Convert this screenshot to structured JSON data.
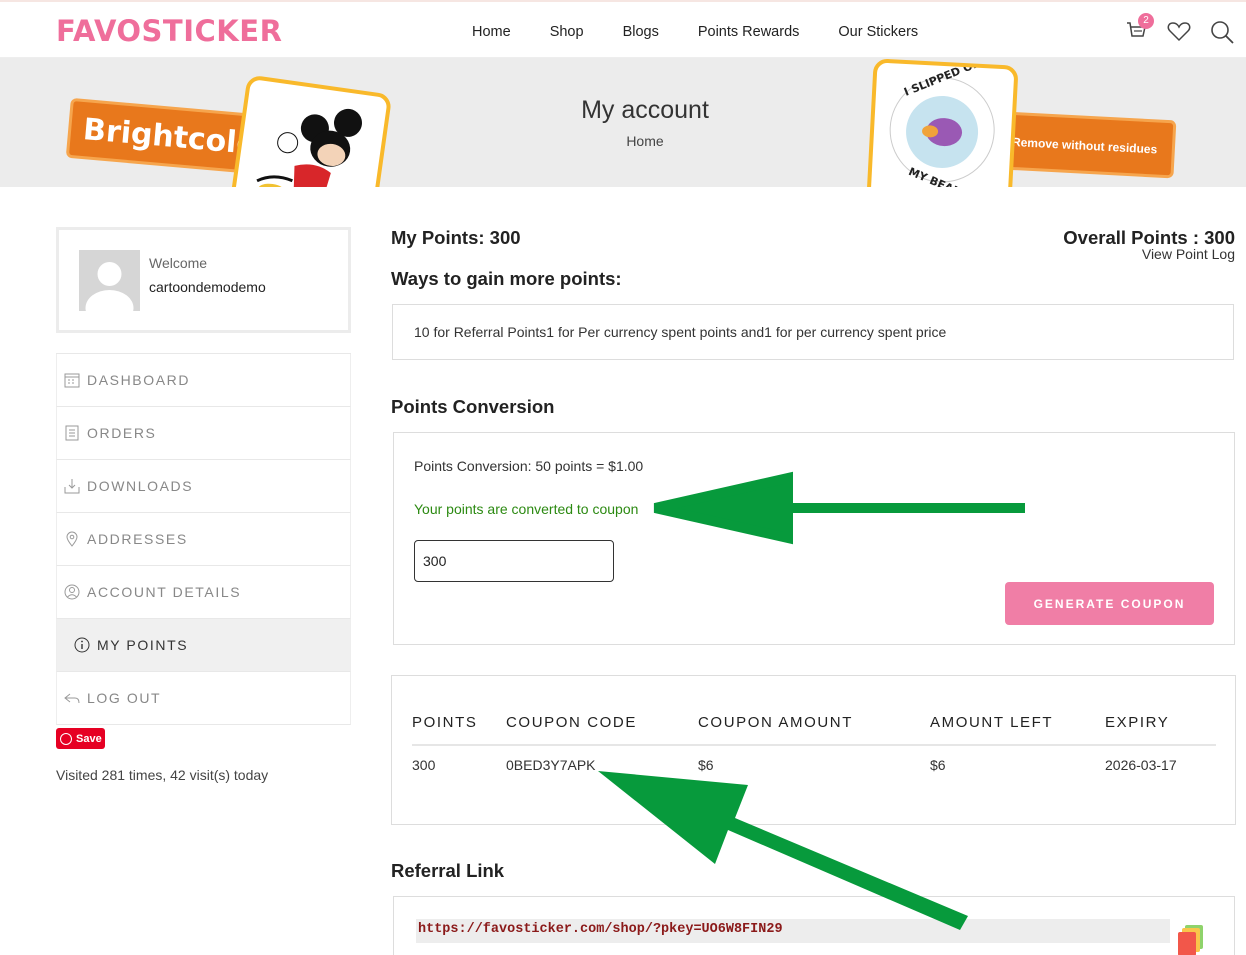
{
  "header": {
    "logo": "FAVOSTICKER",
    "nav": [
      "Home",
      "Shop",
      "Blogs",
      "Points Rewards",
      "Our Stickers"
    ],
    "cart_count": "2",
    "icons": [
      "cart-icon",
      "heart-icon",
      "search-icon"
    ]
  },
  "banner": {
    "title": "My account",
    "breadcrumb": "Home",
    "sticker_left_text": "Brightcolor",
    "sticker_right_text": "Remove without residues",
    "badge_top": "I SLIPPED ON",
    "badge_bottom": "MY BEANS"
  },
  "sidebar": {
    "welcome": "Welcome",
    "username": "cartoondemodemo",
    "menu": [
      {
        "label": "DASHBOARD",
        "icon": "dashboard-icon"
      },
      {
        "label": "ORDERS",
        "icon": "orders-icon"
      },
      {
        "label": "DOWNLOADS",
        "icon": "download-icon"
      },
      {
        "label": "ADDRESSES",
        "icon": "location-pin-icon"
      },
      {
        "label": "ACCOUNT DETAILS",
        "icon": "user-icon"
      },
      {
        "label": "MY POINTS",
        "icon": "info-icon"
      },
      {
        "label": "LOG OUT",
        "icon": "logout-icon"
      }
    ],
    "pinterest_save": "Save",
    "visited": "Visited 281 times, 42 visit(s) today"
  },
  "points": {
    "my_points": "My Points: 300",
    "overall_points": "Overall Points : 300",
    "view_log": "View Point Log",
    "ways_title": "Ways to gain more points:",
    "ways_text": "10 for Referral Points1 for Per currency spent points and1 for per currency spent price"
  },
  "conversion": {
    "title": "Points Conversion",
    "rate": "Points Conversion: 50 points = $1.00",
    "message": "Your points are converted to coupon",
    "input_value": "300",
    "button": "GENERATE COUPON"
  },
  "coupons": {
    "headers": [
      "POINTS",
      "COUPON CODE",
      "COUPON AMOUNT",
      "AMOUNT LEFT",
      "EXPIRY"
    ],
    "rows": [
      [
        "300",
        "0BED3Y7APK",
        "$6",
        "$6",
        "2026-03-17"
      ]
    ]
  },
  "referral": {
    "title": "Referral Link",
    "link": "https://favosticker.com/shop/?pkey=UO6W8FIN29"
  },
  "colors": {
    "brand_pink": "#ef6e9b",
    "button_pink": "#f07ea6",
    "success_green": "#2c8a12",
    "annotation_arrow": "#079a3c"
  }
}
